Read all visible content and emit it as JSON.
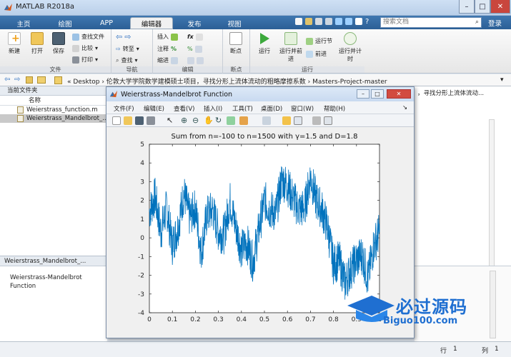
{
  "app": {
    "title": "MATLAB R2018a",
    "colors": {
      "tab_bar": "#2c5f96",
      "plot_line": "#0072bd",
      "accent": "#3f77b0"
    }
  },
  "tabs": [
    {
      "label": "主页"
    },
    {
      "label": "绘图"
    },
    {
      "label": "APP"
    },
    {
      "label": "编辑器",
      "active": true
    },
    {
      "label": "发布"
    },
    {
      "label": "视图"
    }
  ],
  "search": {
    "placeholder": "搜索文档",
    "login_label": "登录"
  },
  "ribbon": {
    "file": {
      "label": "文件",
      "new": "新建",
      "open": "打开",
      "save": "保存",
      "find_files": "查找文件",
      "compare": "比较",
      "print": "打印"
    },
    "navigate": {
      "label": "导航",
      "goto": "转至",
      "find": "查找"
    },
    "edit": {
      "label": "编辑",
      "insert": "插入",
      "comment": "注释",
      "indent": "缩进",
      "fx": "fx"
    },
    "breakpoints": {
      "label": "断点",
      "bp": "断点"
    },
    "run": {
      "label": "运行",
      "run": "运行",
      "run_advance": "运行并前进",
      "run_section": "运行节",
      "advance": "前进",
      "run_time": "运行并计时"
    }
  },
  "address": {
    "path": "« Desktop › 伦敦大学学院数学建模硕士项目，寻找分形上流体流动的粗略摩擦系数 › Masters-Project-master"
  },
  "current_folder": {
    "title": "当前文件夹",
    "column": "名称",
    "files": [
      {
        "name": "Weierstrass_function.m"
      },
      {
        "name": "Weierstrass_Mandelbrot_..."
      }
    ]
  },
  "details": {
    "file_name": "Weierstrass_Mandelbrot_...",
    "description": "Weierstrass-Mandelbrot Function"
  },
  "right_pane": {
    "cut_text": "，寻找分形上流体流动..."
  },
  "figure": {
    "title": "Weierstrass-Mandelbrot Function",
    "menu": [
      "文件(F)",
      "编辑(E)",
      "查看(V)",
      "插入(I)",
      "工具(T)",
      "桌面(D)",
      "窗口(W)",
      "帮助(H)"
    ]
  },
  "status": {
    "row_label": "行",
    "row_value": "1",
    "col_label": "列",
    "col_value": "1"
  },
  "watermark": {
    "text": "必过源码",
    "sub": "Biguo100.com"
  },
  "chart_data": {
    "type": "line",
    "title": "Sum from n=-100 to n=1500 with γ=1.5 and D=1.8",
    "xlabel": "",
    "ylabel": "",
    "xlim": [
      0,
      1
    ],
    "ylim": [
      -4,
      5
    ],
    "xticks": [
      0,
      0.1,
      0.2,
      0.3,
      0.4,
      0.5,
      0.6,
      0.7,
      0.8,
      0.9,
      1
    ],
    "yticks": [
      -4,
      -3,
      -2,
      -1,
      0,
      1,
      2,
      3,
      4,
      5
    ],
    "grid": false,
    "series": [
      {
        "x": [
          0,
          0.025,
          0.05,
          0.075,
          0.1,
          0.125,
          0.15,
          0.175,
          0.2,
          0.225,
          0.25,
          0.275,
          0.3,
          0.325,
          0.35,
          0.375,
          0.4,
          0.425,
          0.45,
          0.475,
          0.5,
          0.525,
          0.55,
          0.575,
          0.6,
          0.625,
          0.65,
          0.675,
          0.7,
          0.725,
          0.75,
          0.775,
          0.8,
          0.825,
          0.85,
          0.875,
          0.9,
          0.925,
          0.95,
          0.975,
          1
        ],
        "y": [
          1.4,
          2.2,
          0.3,
          1.6,
          -0.4,
          0.6,
          2.4,
          1.1,
          1.6,
          -0.8,
          1.2,
          1.5,
          0.3,
          0.2,
          2.0,
          0.6,
          -0.6,
          -0.3,
          -1.3,
          0.4,
          2.0,
          1.5,
          1.3,
          3.1,
          2.8,
          2.1,
          1.5,
          1.6,
          3.3,
          2.0,
          1.5,
          0.5,
          -1.4,
          -1.2,
          -2.4,
          -1.7,
          -1.2,
          -0.9,
          -2.2,
          -0.4,
          0.3
        ]
      }
    ]
  }
}
